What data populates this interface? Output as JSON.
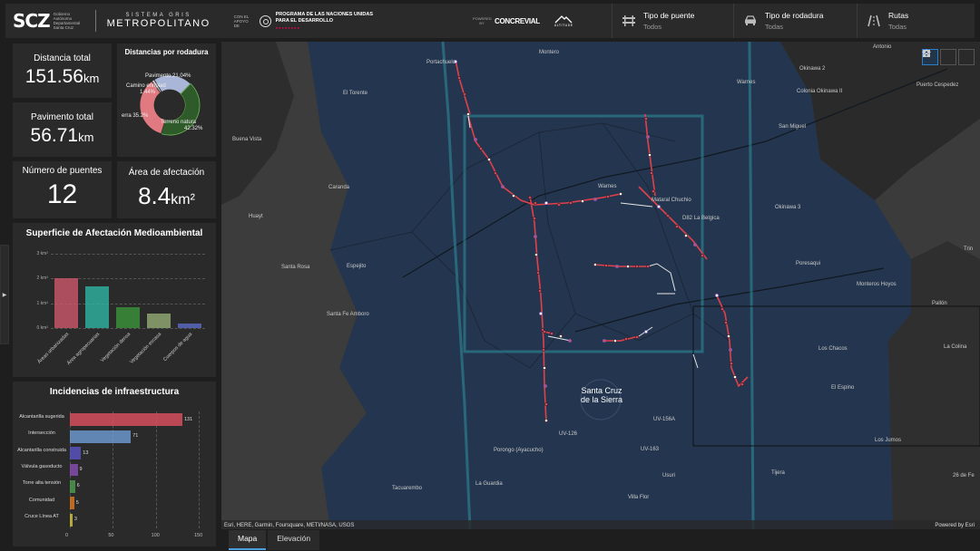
{
  "header": {
    "logo_text": "SCZ",
    "logo_sub": "Gobierno Autónomo Departamental Santa Cruz",
    "sgm_top": "SISTEMA GRIS",
    "sgm_bottom": "METROPOLITANO",
    "cohost": "CON EL APOYO DE",
    "undp_line1": "PROGRAMA DE LAS NACIONES UNIDAS",
    "undp_line2": "PARA EL DESARROLLO",
    "powered": "POWERED BY",
    "concrevial": "CONCREVIAL",
    "altitude": "ALTITUDE",
    "filters": [
      {
        "title": "Tipo de puente",
        "value": "Todos",
        "icon": "bridge-icon"
      },
      {
        "title": "Tipo de rodadura",
        "value": "Todas",
        "icon": "car-icon"
      },
      {
        "title": "Rutas",
        "value": "Todas",
        "icon": "road-icon"
      }
    ]
  },
  "kpis": {
    "distancia_total": {
      "title": "Distancia total",
      "value": "151.56",
      "unit": "km"
    },
    "pavimento_total": {
      "title": "Pavimento total",
      "value": "56.71",
      "unit": "km"
    },
    "numero_puentes": {
      "title": "Número de puentes",
      "value": "12"
    },
    "area_afectacion": {
      "title": "Área de afectación",
      "value": "8.4",
      "unit": "km²"
    }
  },
  "donut": {
    "title": "Distancias por rodadura",
    "slices": [
      {
        "label": "Pavimento",
        "pct": 21.04,
        "color": "#a9b6d8"
      },
      {
        "label": "Terreno natural",
        "pct": 42.32,
        "color": "#2f5a2a"
      },
      {
        "label": "Tierra",
        "pct": 35.2,
        "color": "#e07a80"
      },
      {
        "label": "Camino enripiado",
        "pct": 1.44,
        "color": "#c9c9c9"
      }
    ],
    "label_pavimento": "Pavimento 21.04%",
    "label_camino": "Camino enripiad",
    "label_camino_pct": "1.44%",
    "label_tierra": "erra 35.2%",
    "label_terreno": "Terreno natura",
    "label_terreno_pct": "42.32%"
  },
  "chart_data": [
    {
      "type": "bar",
      "title": "Superficie de Afectación Medioambiental",
      "categories": [
        "Áreas urbanizadas",
        "Área agropecuarias",
        "Vegetación densa",
        "Vegetación escasa",
        "Cuerpos de agua"
      ],
      "values": [
        2.0,
        1.7,
        0.85,
        0.6,
        0.18
      ],
      "colors": [
        "#d85a70",
        "#2ebfaa",
        "#3c9a3a",
        "#9ab57a",
        "#5f6fd0"
      ],
      "ylim": [
        0,
        3
      ],
      "yticks": [
        "0 km²",
        "1 km²",
        "2 km²",
        "3 km²"
      ]
    },
    {
      "type": "bar",
      "orientation": "horizontal",
      "title": "Incidencias de infraestructura",
      "categories": [
        "Alcantarilla sugerida",
        "Intersección",
        "Alcantarilla construida",
        "Válvula gasoducto",
        "Torre alta tensión",
        "Comunidad",
        "Cruce Línea AT"
      ],
      "values": [
        131,
        71,
        13,
        9,
        6,
        5,
        3
      ],
      "colors": [
        "#e05060",
        "#6f9ed6",
        "#5a55c8",
        "#8a4fb5",
        "#4fa050",
        "#e07a20",
        "#d8c840"
      ],
      "xlim": [
        0,
        150
      ],
      "xticks": [
        "0",
        "50",
        "100",
        "150"
      ]
    }
  ],
  "map": {
    "attribution": "Esri, HERE, Garmin, Foursquare, METI/NASA, USGS",
    "powered_by": "Powered by Esri",
    "labels": [
      {
        "text": "Portachuelo",
        "cls": ""
      },
      {
        "text": "Montero",
        "cls": ""
      },
      {
        "text": "Antonio",
        "cls": ""
      },
      {
        "text": "Okinawa 2",
        "cls": ""
      },
      {
        "text": "Puerto Cespedez",
        "cls": ""
      },
      {
        "text": "El Torente",
        "cls": ""
      },
      {
        "text": "Warnes",
        "cls": ""
      },
      {
        "text": "Colonia Okinawa II",
        "cls": ""
      },
      {
        "text": "San Miguel",
        "cls": ""
      },
      {
        "text": "Buena Vista",
        "cls": ""
      },
      {
        "text": "Caranda",
        "cls": ""
      },
      {
        "text": "Warnes",
        "cls": ""
      },
      {
        "text": "Huayt",
        "cls": ""
      },
      {
        "text": "Okinawa 3",
        "cls": ""
      },
      {
        "text": "Espejito",
        "cls": ""
      },
      {
        "text": "Santa Rosa",
        "cls": ""
      },
      {
        "text": "Poresaqui",
        "cls": ""
      },
      {
        "text": "Monteros Hoyos",
        "cls": ""
      },
      {
        "text": "Pallón",
        "cls": ""
      },
      {
        "text": "Santa Fe Amboro",
        "cls": ""
      },
      {
        "text": "Los Chacos",
        "cls": ""
      },
      {
        "text": "La Colina",
        "cls": ""
      },
      {
        "text": "Santa Cruz de la Sierra",
        "cls": "city"
      },
      {
        "text": "El Espino",
        "cls": ""
      },
      {
        "text": "UV-156A",
        "cls": ""
      },
      {
        "text": "UV-126",
        "cls": ""
      },
      {
        "text": "Los Jumos",
        "cls": ""
      },
      {
        "text": "Porongo (Ayacucho)",
        "cls": ""
      },
      {
        "text": "UV-163",
        "cls": ""
      },
      {
        "text": "Tacuarembo",
        "cls": ""
      },
      {
        "text": "Usuri",
        "cls": ""
      },
      {
        "text": "Tijera",
        "cls": ""
      },
      {
        "text": "La Guardia",
        "cls": ""
      },
      {
        "text": "Villa Flor",
        "cls": ""
      },
      {
        "text": "26 de Fe",
        "cls": ""
      },
      {
        "text": "Trin",
        "cls": ""
      },
      {
        "text": "Mataral Chuchio",
        "cls": ""
      },
      {
        "text": "D82 La Belgica",
        "cls": ""
      }
    ]
  },
  "tabs": [
    "Mapa",
    "Elevación"
  ]
}
